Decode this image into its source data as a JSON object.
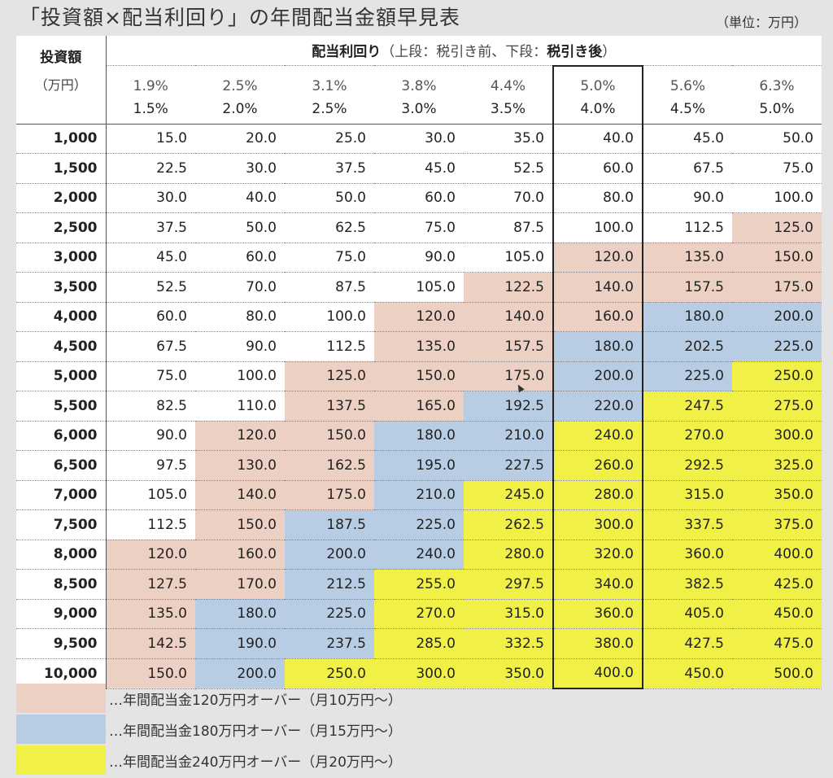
{
  "title": "「投資額×配当利回り」の年間配当金額早見表",
  "unit": "（単位：万円）",
  "header": {
    "investment_label": "投資額",
    "investment_unit": "（万円）",
    "ratio_label": "配当利回り",
    "ratio_note_pre": "（上段：税引き前、下段：",
    "ratio_note_bold": "税引き後",
    "ratio_note_post": "）"
  },
  "yields_pre": [
    "1.9%",
    "2.5%",
    "3.1%",
    "3.8%",
    "4.4%",
    "5.0%",
    "5.6%",
    "6.3%"
  ],
  "yields_post": [
    "1.5%",
    "2.0%",
    "2.5%",
    "3.0%",
    "3.5%",
    "4.0%",
    "4.5%",
    "5.0%"
  ],
  "rows": [
    {
      "inv": "1,000",
      "vals": [
        "15.0",
        "20.0",
        "25.0",
        "30.0",
        "35.0",
        "40.0",
        "45.0",
        "50.0"
      ],
      "cls": [
        0,
        0,
        0,
        0,
        0,
        0,
        0,
        0
      ]
    },
    {
      "inv": "1,500",
      "vals": [
        "22.5",
        "30.0",
        "37.5",
        "45.0",
        "52.5",
        "60.0",
        "67.5",
        "75.0"
      ],
      "cls": [
        0,
        0,
        0,
        0,
        0,
        0,
        0,
        0
      ]
    },
    {
      "inv": "2,000",
      "vals": [
        "30.0",
        "40.0",
        "50.0",
        "60.0",
        "70.0",
        "80.0",
        "90.0",
        "100.0"
      ],
      "cls": [
        0,
        0,
        0,
        0,
        0,
        0,
        0,
        0
      ]
    },
    {
      "inv": "2,500",
      "vals": [
        "37.5",
        "50.0",
        "62.5",
        "75.0",
        "87.5",
        "100.0",
        "112.5",
        "125.0"
      ],
      "cls": [
        0,
        0,
        0,
        0,
        0,
        0,
        0,
        1
      ]
    },
    {
      "inv": "3,000",
      "vals": [
        "45.0",
        "60.0",
        "75.0",
        "90.0",
        "105.0",
        "120.0",
        "135.0",
        "150.0"
      ],
      "cls": [
        0,
        0,
        0,
        0,
        0,
        1,
        1,
        1
      ]
    },
    {
      "inv": "3,500",
      "vals": [
        "52.5",
        "70.0",
        "87.5",
        "105.0",
        "122.5",
        "140.0",
        "157.5",
        "175.0"
      ],
      "cls": [
        0,
        0,
        0,
        0,
        1,
        1,
        1,
        1
      ]
    },
    {
      "inv": "4,000",
      "vals": [
        "60.0",
        "80.0",
        "100.0",
        "120.0",
        "140.0",
        "160.0",
        "180.0",
        "200.0"
      ],
      "cls": [
        0,
        0,
        0,
        1,
        1,
        1,
        2,
        2
      ]
    },
    {
      "inv": "4,500",
      "vals": [
        "67.5",
        "90.0",
        "112.5",
        "135.0",
        "157.5",
        "180.0",
        "202.5",
        "225.0"
      ],
      "cls": [
        0,
        0,
        0,
        1,
        1,
        2,
        2,
        2
      ]
    },
    {
      "inv": "5,000",
      "vals": [
        "75.0",
        "100.0",
        "125.0",
        "150.0",
        "175.0",
        "200.0",
        "225.0",
        "250.0"
      ],
      "cls": [
        0,
        0,
        1,
        1,
        1,
        2,
        2,
        3
      ]
    },
    {
      "inv": "5,500",
      "vals": [
        "82.5",
        "110.0",
        "137.5",
        "165.0",
        "192.5",
        "220.0",
        "247.5",
        "275.0"
      ],
      "cls": [
        0,
        0,
        1,
        1,
        2,
        2,
        3,
        3
      ]
    },
    {
      "inv": "6,000",
      "vals": [
        "90.0",
        "120.0",
        "150.0",
        "180.0",
        "210.0",
        "240.0",
        "270.0",
        "300.0"
      ],
      "cls": [
        0,
        1,
        1,
        2,
        2,
        3,
        3,
        3
      ]
    },
    {
      "inv": "6,500",
      "vals": [
        "97.5",
        "130.0",
        "162.5",
        "195.0",
        "227.5",
        "260.0",
        "292.5",
        "325.0"
      ],
      "cls": [
        0,
        1,
        1,
        2,
        2,
        3,
        3,
        3
      ]
    },
    {
      "inv": "7,000",
      "vals": [
        "105.0",
        "140.0",
        "175.0",
        "210.0",
        "245.0",
        "280.0",
        "315.0",
        "350.0"
      ],
      "cls": [
        0,
        1,
        1,
        2,
        3,
        3,
        3,
        3
      ]
    },
    {
      "inv": "7,500",
      "vals": [
        "112.5",
        "150.0",
        "187.5",
        "225.0",
        "262.5",
        "300.0",
        "337.5",
        "375.0"
      ],
      "cls": [
        0,
        1,
        2,
        2,
        3,
        3,
        3,
        3
      ]
    },
    {
      "inv": "8,000",
      "vals": [
        "120.0",
        "160.0",
        "200.0",
        "240.0",
        "280.0",
        "320.0",
        "360.0",
        "400.0"
      ],
      "cls": [
        1,
        1,
        2,
        2,
        3,
        3,
        3,
        3
      ]
    },
    {
      "inv": "8,500",
      "vals": [
        "127.5",
        "170.0",
        "212.5",
        "255.0",
        "297.5",
        "340.0",
        "382.5",
        "425.0"
      ],
      "cls": [
        1,
        1,
        2,
        3,
        3,
        3,
        3,
        3
      ]
    },
    {
      "inv": "9,000",
      "vals": [
        "135.0",
        "180.0",
        "225.0",
        "270.0",
        "315.0",
        "360.0",
        "405.0",
        "450.0"
      ],
      "cls": [
        1,
        2,
        2,
        3,
        3,
        3,
        3,
        3
      ]
    },
    {
      "inv": "9,500",
      "vals": [
        "142.5",
        "190.0",
        "237.5",
        "285.0",
        "332.5",
        "380.0",
        "427.5",
        "475.0"
      ],
      "cls": [
        1,
        2,
        2,
        3,
        3,
        3,
        3,
        3
      ]
    },
    {
      "inv": "10,000",
      "vals": [
        "150.0",
        "200.0",
        "250.0",
        "300.0",
        "350.0",
        "400.0",
        "450.0",
        "500.0"
      ],
      "cls": [
        1,
        2,
        3,
        3,
        3,
        3,
        3,
        3
      ]
    }
  ],
  "legend": [
    {
      "text": "…年間配当金120万円オーバー（月10万円～）",
      "color": "#ecd0c4"
    },
    {
      "text": "…年間配当金180万円オーバー（月15万円～）",
      "color": "#b8cde3"
    },
    {
      "text": "…年間配当金240万円オーバー（月20万円～）",
      "color": "#f0f046"
    }
  ],
  "highlight_column": 5
}
